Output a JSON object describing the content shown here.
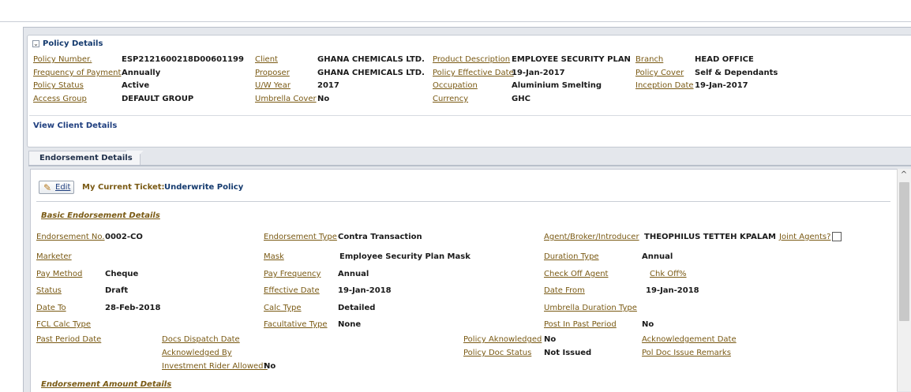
{
  "policy": {
    "section_title": "Policy Details",
    "collapse_glyph": "⌄",
    "fields": [
      {
        "label": "Policy Number.",
        "value": "ESP2121600218D00601199"
      },
      {
        "label": "Frequency of Payment",
        "value": "Annually"
      },
      {
        "label": "Policy Status",
        "value": "Active"
      },
      {
        "label": "Access Group",
        "value": "DEFAULT GROUP"
      },
      {
        "label": "Client",
        "value": "GHANA CHEMICALS LTD."
      },
      {
        "label": "Proposer",
        "value": "GHANA CHEMICALS LTD."
      },
      {
        "label": "U/W Year",
        "value": "2017"
      },
      {
        "label": "Umbrella Cover",
        "value": "No"
      },
      {
        "label": "Product Description",
        "value": "EMPLOYEE SECURITY PLAN"
      },
      {
        "label": "Policy Effective Date",
        "value": "19-Jan-2017"
      },
      {
        "label": "Occupation",
        "value": "Aluminium Smelting"
      },
      {
        "label": "Currency",
        "value": "GHC"
      },
      {
        "label": "Branch",
        "value": "HEAD OFFICE"
      },
      {
        "label": "Policy Cover",
        "value": "Self & Dependants"
      },
      {
        "label": "Inception Date",
        "value": "19-Jan-2017"
      }
    ],
    "view_client_link": "View Client Details"
  },
  "tab": {
    "label": "Endorsement Details"
  },
  "toolbar": {
    "edit_label": "Edit",
    "ticket_label": "My Current Ticket:",
    "ticket_value": "Underwrite Policy"
  },
  "endorsement": {
    "basic_header": "Basic Endorsement Details",
    "amount_header": "Endorsement Amount Details",
    "fields": [
      {
        "label": "Endorsement No.",
        "value": "0002-CO"
      },
      {
        "label": "Marketer",
        "value": ""
      },
      {
        "label": "Pay Method",
        "value": "Cheque"
      },
      {
        "label": "Status",
        "value": "Draft"
      },
      {
        "label": "Date To",
        "value": "28-Feb-2018"
      },
      {
        "label": "FCL Calc Type",
        "value": ""
      },
      {
        "label": "Past Period Date",
        "value": ""
      },
      {
        "label": "Endorsement Type",
        "value": "Contra Transaction"
      },
      {
        "label": "Mask",
        "value": "Employee Security Plan Mask"
      },
      {
        "label": "Pay Frequency",
        "value": "Annual"
      },
      {
        "label": "Effective Date",
        "value": "19-Jan-2018"
      },
      {
        "label": "Calc Type",
        "value": "Detailed"
      },
      {
        "label": "Facultative Type",
        "value": "None"
      },
      {
        "label": "Agent/Broker/Introducer",
        "value": "THEOPHILUS TETTEH KPALAM"
      },
      {
        "label": "Duration Type",
        "value": "Annual"
      },
      {
        "label": "Check Off Agent",
        "value": ""
      },
      {
        "label": "Date From",
        "value": "19-Jan-2018"
      },
      {
        "label": "Umbrella Duration Type",
        "value": ""
      },
      {
        "label": "Post In Past Period",
        "value": "No"
      },
      {
        "label": "Docs Dispatch Date",
        "value": ""
      },
      {
        "label": "Acknowledged By",
        "value": ""
      },
      {
        "label": "Investment Rider Allowed?",
        "value": "No"
      },
      {
        "label": "Policy Aknowledged",
        "value": "No"
      },
      {
        "label": "Policy Doc Status",
        "value": "Not Issued"
      },
      {
        "label": "Acknowledgement Date",
        "value": ""
      },
      {
        "label": "Pol Doc Issue Remarks",
        "value": ""
      }
    ],
    "joint_agents_label": "Joint Agents?",
    "chk_off_label": "Chk Off%"
  },
  "scrollbar": {
    "up_glyph": "^"
  }
}
